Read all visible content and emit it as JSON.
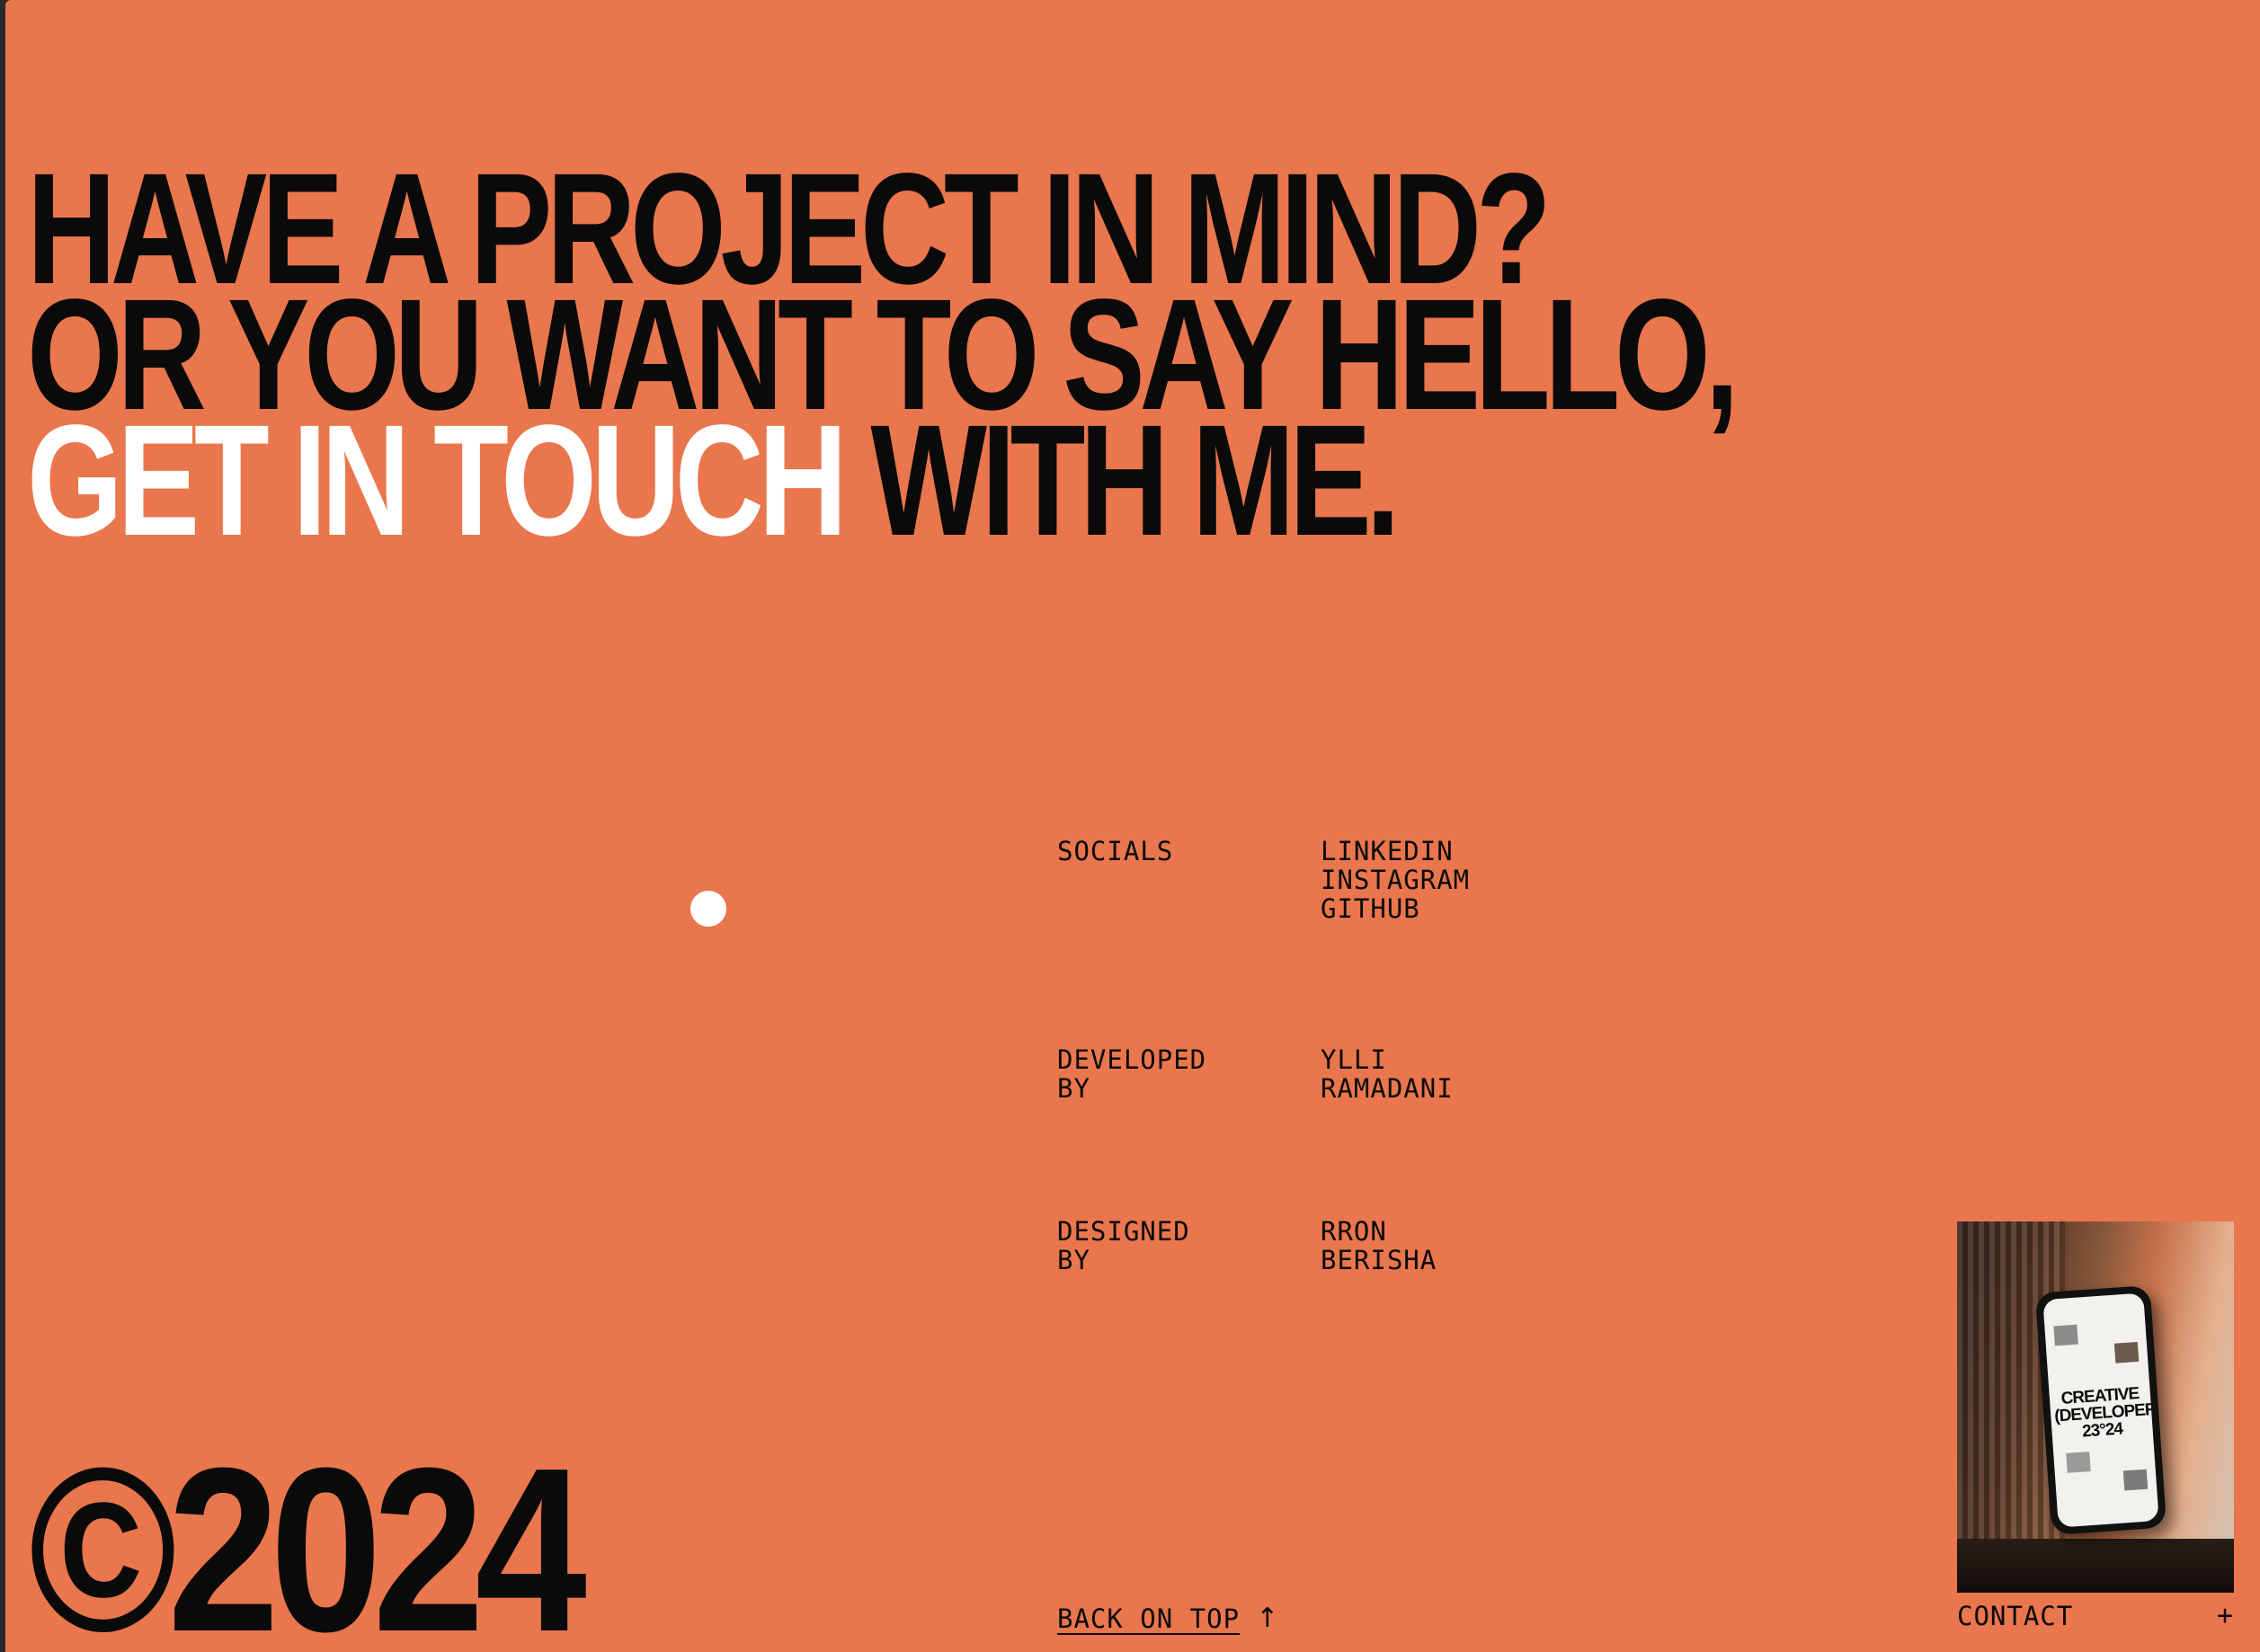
{
  "hero": {
    "line1": "HAVE A PROJECT IN MIND?",
    "line2": "OR YOU WANT TO SAY HELLO,",
    "line3_highlight": "GET IN TOUCH",
    "line3_rest": " WITH ME."
  },
  "info": {
    "socials": {
      "label": "SOCIALS",
      "links": [
        "LINKEDIN",
        "INSTAGRAM",
        "GITHUB"
      ]
    },
    "developed": {
      "label_line1": "DEVELOPED",
      "label_line2": "BY",
      "value_line1": "YLLI",
      "value_line2": "RAMADANI"
    },
    "designed": {
      "label_line1": "DESIGNED",
      "label_line2": "BY",
      "value_line1": "RRON",
      "value_line2": "BERISHA"
    }
  },
  "footer": {
    "copyright": "©2024",
    "back_on_top": "BACK ON TOP",
    "back_arrow": "↑",
    "contact_label": "CONTACT",
    "contact_plus": "+"
  },
  "thumbnail": {
    "phone_text_line1": "CREATIVE",
    "phone_text_line2": "(DEVELOPER)",
    "phone_text_line3": "23°24"
  },
  "colors": {
    "background": "#E9764D",
    "text": "#0a0a0a",
    "highlight": "#ffffff"
  }
}
